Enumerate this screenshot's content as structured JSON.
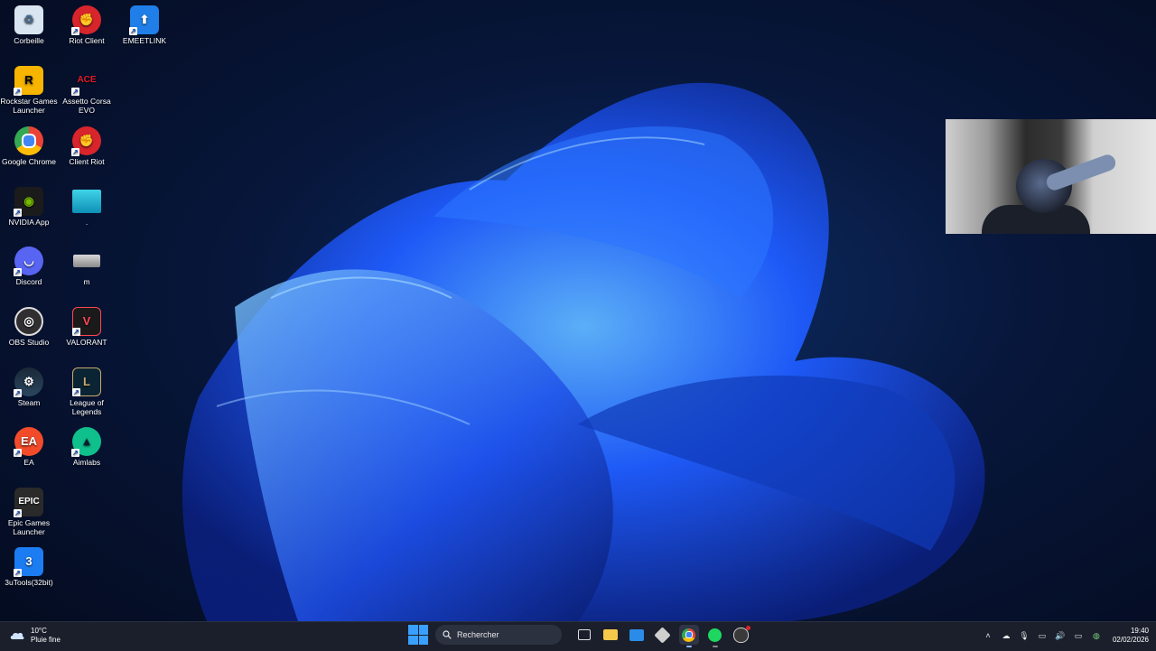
{
  "desktop": {
    "icons": [
      {
        "label": "Corbeille",
        "icon": "recycle-bin-icon"
      },
      {
        "label": "Riot Client",
        "icon": "riot-client-icon"
      },
      {
        "label": "EMEETLINK",
        "icon": "emeetlink-icon"
      },
      {
        "label": "Rockstar Games Launcher",
        "icon": "rockstar-icon"
      },
      {
        "label": "Assetto Corsa EVO",
        "icon": "assetto-corsa-icon"
      },
      {
        "label": "Google Chrome",
        "icon": "chrome-icon"
      },
      {
        "label": "Client Riot",
        "icon": "riot-client-icon"
      },
      {
        "label": "NVIDIA App",
        "icon": "nvidia-icon"
      },
      {
        "label": ".",
        "icon": "monitor-icon"
      },
      {
        "label": "Discord",
        "icon": "discord-icon"
      },
      {
        "label": "m",
        "icon": "drive-icon"
      },
      {
        "label": "OBS Studio",
        "icon": "obs-icon"
      },
      {
        "label": "VALORANT",
        "icon": "valorant-icon"
      },
      {
        "label": "Steam",
        "icon": "steam-icon"
      },
      {
        "label": "League of Legends",
        "icon": "league-icon"
      },
      {
        "label": "EA",
        "icon": "ea-icon"
      },
      {
        "label": "Aimlabs",
        "icon": "aimlabs-icon"
      },
      {
        "label": "Epic Games Launcher",
        "icon": "epic-icon"
      },
      {
        "label": "3uTools(32bit)",
        "icon": "3utools-icon"
      }
    ]
  },
  "taskbar": {
    "weather": {
      "temp": "10°C",
      "desc": "Pluie fine"
    },
    "search_placeholder": "Rechercher",
    "apps": [
      "task-view-icon",
      "file-explorer-icon",
      "mail-icon",
      "app-icon",
      "chrome-icon",
      "spotify-icon",
      "riot-client-icon"
    ],
    "clock": {
      "time": "19:40",
      "date": "02/02/2026"
    }
  },
  "colors": {
    "accent": "#3aa0ff",
    "taskbar_bg": "#1b1f2b"
  }
}
